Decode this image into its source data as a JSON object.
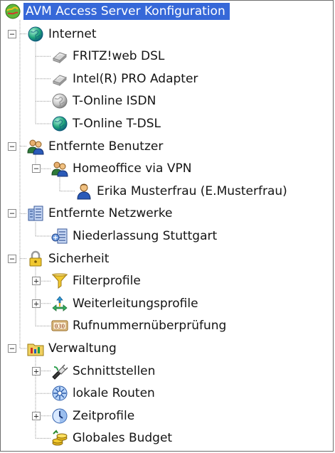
{
  "tree": {
    "root": {
      "label": "AVM Access Server Konfiguration",
      "icon": "avm-globe-icon",
      "selected": true
    },
    "nodes": [
      {
        "label": "Internet",
        "icon": "globe-icon",
        "expander": "−",
        "children": [
          {
            "label": "FRITZ!web DSL",
            "icon": "network-adapter-gray-icon"
          },
          {
            "label": "Intel(R) PRO Adapter",
            "icon": "network-adapter-gray-icon"
          },
          {
            "label": "T-Online ISDN",
            "icon": "globe-gray-icon"
          },
          {
            "label": "T-Online T-DSL",
            "icon": "globe-icon"
          }
        ]
      },
      {
        "label": "Entfernte Benutzer",
        "icon": "users-icon",
        "expander": "−",
        "children": [
          {
            "label": "Homeoffice via VPN",
            "icon": "users-icon",
            "expander": "−",
            "children": [
              {
                "label": "Erika Musterfrau (E.Musterfrau)",
                "icon": "user-icon"
              }
            ]
          }
        ]
      },
      {
        "label": "Entfernte Netzwerke",
        "icon": "buildings-icon",
        "expander": "−",
        "children": [
          {
            "label": "Niederlassung Stuttgart",
            "icon": "building-icon"
          }
        ]
      },
      {
        "label": "Sicherheit",
        "icon": "padlock-icon",
        "expander": "−",
        "children": [
          {
            "label": "Filterprofile",
            "icon": "filter-funnel-icon",
            "expander": "+"
          },
          {
            "label": "Weiterleitungsprofile",
            "icon": "forwarding-arrows-icon",
            "expander": "+"
          },
          {
            "label": "Rufnummernüberprüfung",
            "icon": "phone-number-check-icon"
          }
        ]
      },
      {
        "label": "Verwaltung",
        "icon": "admin-folder-icon",
        "expander": "−",
        "children": [
          {
            "label": "Schnittstellen",
            "icon": "interfaces-icon",
            "expander": "+"
          },
          {
            "label": "lokale Routen",
            "icon": "routes-icon"
          },
          {
            "label": "Zeitprofile",
            "icon": "time-profile-icon",
            "expander": "+"
          },
          {
            "label": "Globales Budget",
            "icon": "budget-coins-icon"
          }
        ]
      }
    ]
  }
}
